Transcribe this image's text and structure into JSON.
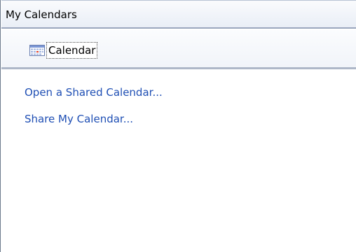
{
  "section": {
    "title": "My Calendars"
  },
  "calendar_item": {
    "label": "Calendar",
    "icon": "calendar-icon"
  },
  "links": [
    {
      "label": "Open a Shared Calendar..."
    },
    {
      "label": "Share My Calendar..."
    }
  ],
  "colors": {
    "link": "#1f4fb4",
    "header_border": "#9aa6bd"
  }
}
